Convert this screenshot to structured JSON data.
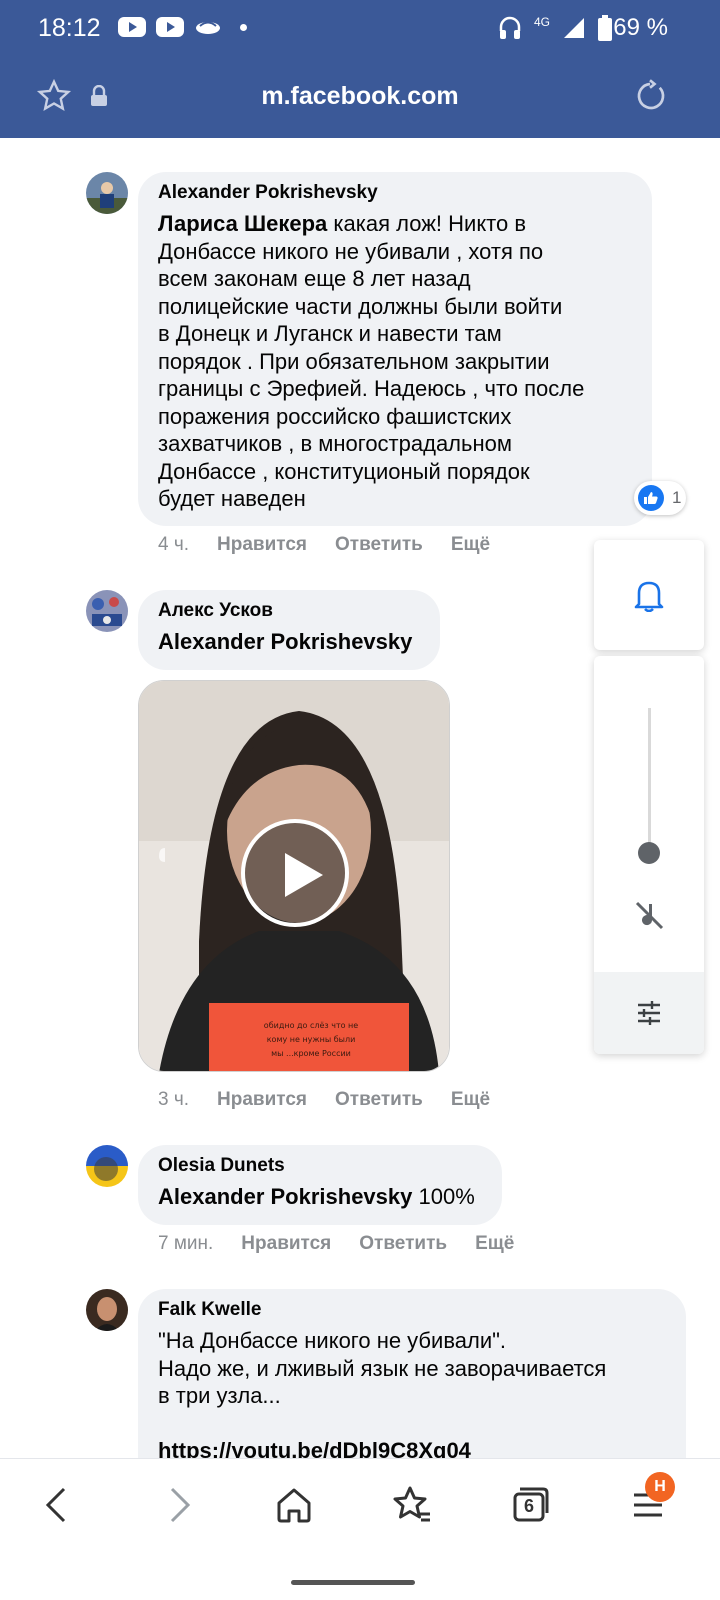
{
  "status_bar": {
    "time": "18:12",
    "network": "4G",
    "battery": "69 %"
  },
  "browser": {
    "url": "m.facebook.com"
  },
  "comments": [
    {
      "author": "Alexander Pokrishevsky",
      "mention": "Лариса Шекера",
      "lines": [
        " какая лож! Никто в",
        "Донбассе никого не убивали , хотя по",
        "всем законам еще 8 лет назад",
        "полицейские части должны были войти",
        "в Донецк и Луганск и навести там",
        "порядок . При обязательном закрытии",
        "границы с Эрефией. Надеюсь , что после",
        "поражения российско фашистских",
        "захватчиков , в многострадальном",
        "Донбассе , конституционый порядок",
        "будет наведен"
      ],
      "reactions": "1",
      "time": "4 ч.",
      "like": "Нравится",
      "reply": "Ответить",
      "more": "Ещё"
    },
    {
      "author": "Алекс Усков",
      "mention": "Alexander Pokrishevsky",
      "time": "3 ч.",
      "like": "Нравится",
      "reply": "Ответить",
      "more": "Ещё",
      "video_caption": "обидно до слёз что не\nкому не нужны были\nмы ...кроме России"
    },
    {
      "author": "Olesia Dunets",
      "mention": "Alexander Pokrishevsky",
      "rest": " 100%",
      "time": "7 мин.",
      "like": "Нравится",
      "reply": "Ответить",
      "more": "Ещё"
    },
    {
      "author": "Falk Kwelle",
      "lines": [
        "\"На Донбассе никого не убивали\".",
        "Надо же, и лживый язык не заворачивается",
        "в три узла..."
      ],
      "link": "https://youtu.be/dDbl9C8Xq04"
    }
  ],
  "bottom_nav": {
    "tabs_count": "6",
    "menu_badge": "H"
  },
  "colors": {
    "facebook_blue": "#3b5998",
    "bubble": "#f0f2f5",
    "like_blue": "#1877f2",
    "badge_orange": "#f26522"
  }
}
